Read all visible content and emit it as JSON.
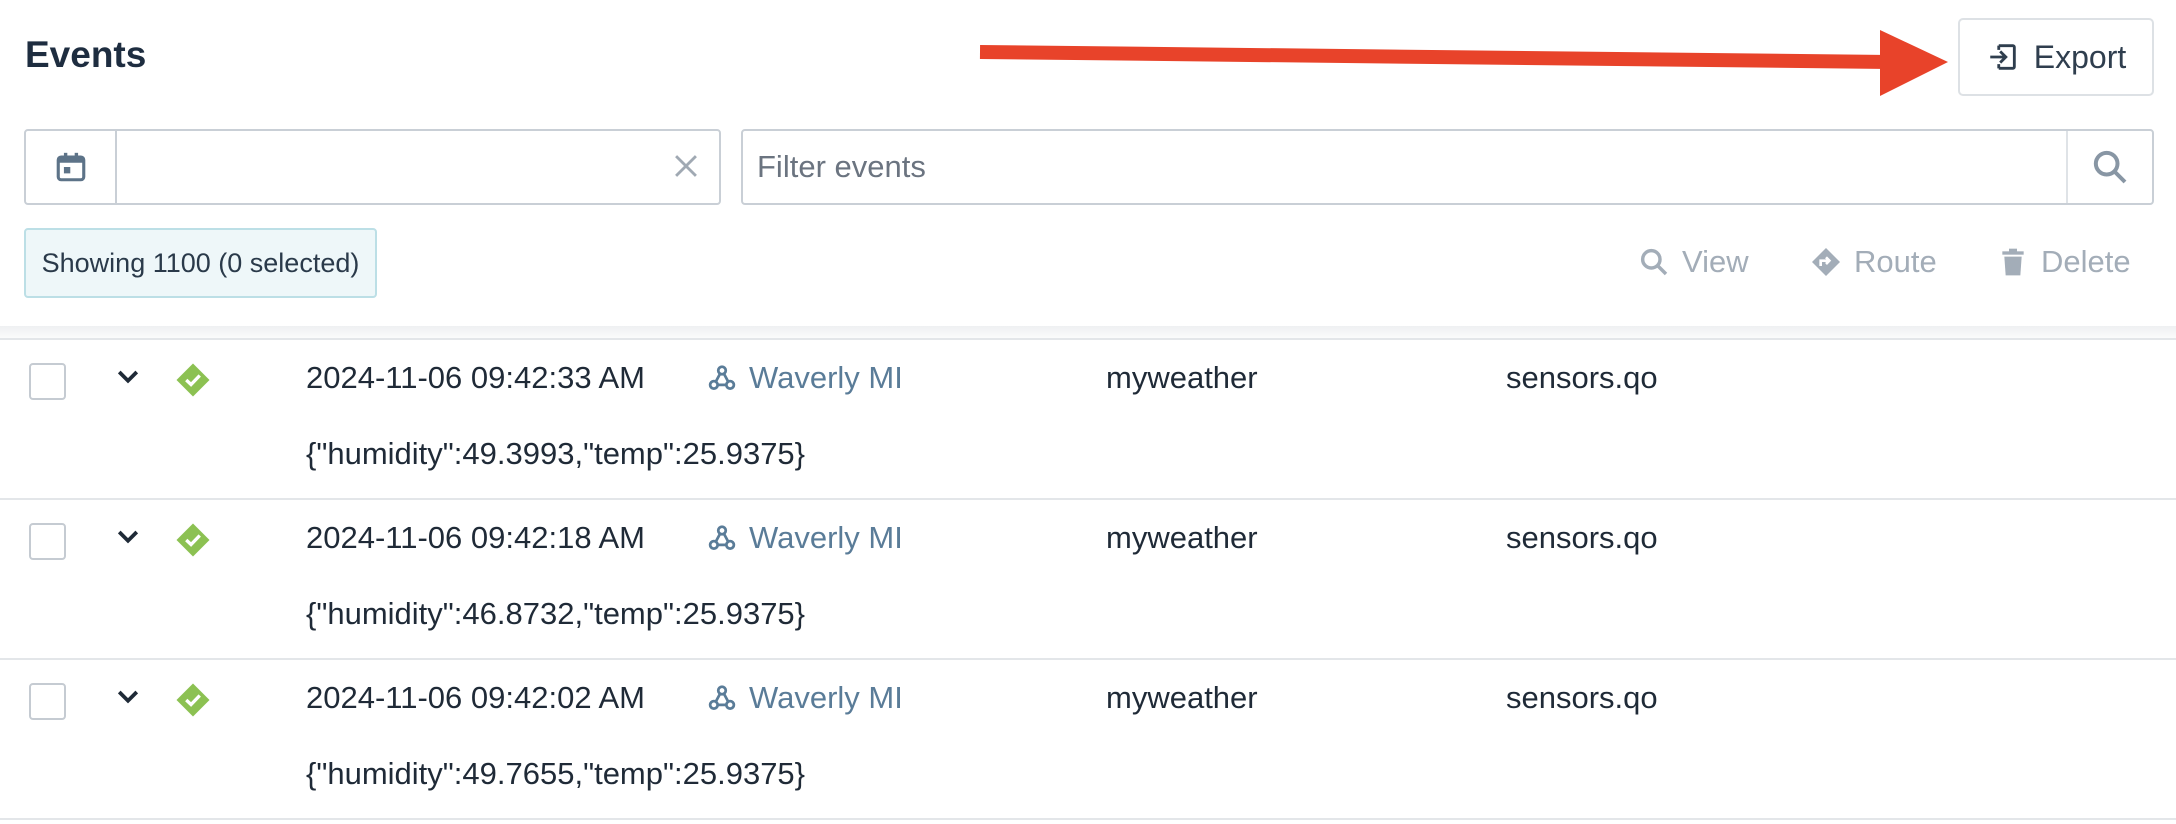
{
  "header": {
    "title": "Events",
    "export_label": "Export"
  },
  "filters": {
    "date_value": "",
    "search_placeholder": "Filter events"
  },
  "summary": {
    "showing_text": "Showing 1100 (0 selected)"
  },
  "actions": {
    "view_label": "View",
    "route_label": "Route",
    "delete_label": "Delete"
  },
  "colors": {
    "annotation_arrow": "#e8432a",
    "status_ok": "#8cc152",
    "device_link": "#5a7c98",
    "muted_action": "#a3adb8"
  },
  "events": [
    {
      "time": "2024-11-06 09:42:33 AM",
      "device": "Waverly MI",
      "project": "myweather",
      "file": "sensors.qo",
      "body": "{\"humidity\":49.3993,\"temp\":25.9375}"
    },
    {
      "time": "2024-11-06 09:42:18 AM",
      "device": "Waverly MI",
      "project": "myweather",
      "file": "sensors.qo",
      "body": "{\"humidity\":46.8732,\"temp\":25.9375}"
    },
    {
      "time": "2024-11-06 09:42:02 AM",
      "device": "Waverly MI",
      "project": "myweather",
      "file": "sensors.qo",
      "body": "{\"humidity\":49.7655,\"temp\":25.9375}"
    }
  ]
}
